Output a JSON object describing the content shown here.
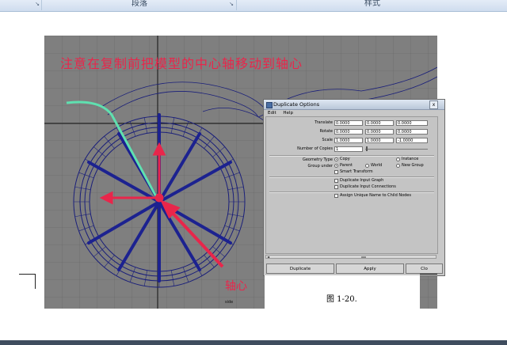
{
  "ribbon": {
    "groups": [
      "段落",
      "样式"
    ]
  },
  "figure": {
    "instruction": "注意在复制前把模型的中心轴移动到轴心",
    "pivot_label": "轴心",
    "viewport_label": "side",
    "caption": "图 1-20."
  },
  "dialog": {
    "title": "Duplicate Options",
    "close_glyph": "x",
    "menu": [
      "Edit",
      "Help"
    ],
    "translate": {
      "label": "Translate",
      "values": [
        "0.0000",
        "0.0000",
        "0.0000"
      ]
    },
    "rotate": {
      "label": "Rotate",
      "values": [
        "0.0000",
        "0.0000",
        "0.0000"
      ]
    },
    "scale": {
      "label": "Scale",
      "values": [
        "1.0000",
        "1.0000",
        "-1.0000"
      ]
    },
    "copies": {
      "label": "Number of Copies",
      "value": "1"
    },
    "geometry_type": {
      "label": "Geometry Type",
      "options": [
        "Copy",
        "Instance"
      ],
      "selected": "Copy"
    },
    "group_under": {
      "label": "Group under",
      "options": [
        "Parent",
        "World",
        "New Group"
      ],
      "selected": "Parent"
    },
    "smart_transform": "Smart Transform",
    "dup_input_graph": "Duplicate Input Graph",
    "dup_input_connections": "Duplicate Input Connections",
    "assign_unique_name": "Assign Unique Name to Child Nodes",
    "buttons": {
      "duplicate": "Duplicate",
      "apply": "Apply",
      "close": "Clo"
    }
  },
  "colors": {
    "annotation": "#e8264b",
    "wireframe": "#1a1f7a",
    "viewport_bg": "#7f7f7f",
    "curve_highlight": "#5fe0b0"
  }
}
